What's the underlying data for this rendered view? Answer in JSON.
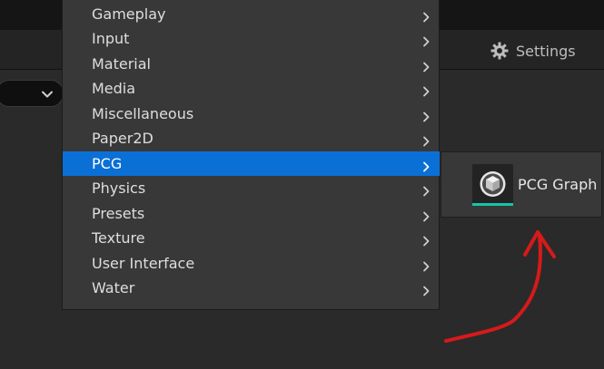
{
  "toolbar": {
    "settings_label": "Settings"
  },
  "menu": {
    "items": [
      {
        "label": "Gameplay"
      },
      {
        "label": "Input"
      },
      {
        "label": "Material"
      },
      {
        "label": "Media"
      },
      {
        "label": "Miscellaneous"
      },
      {
        "label": "Paper2D"
      },
      {
        "label": "PCG"
      },
      {
        "label": "Physics"
      },
      {
        "label": "Presets"
      },
      {
        "label": "Texture"
      },
      {
        "label": "User Interface"
      },
      {
        "label": "Water"
      }
    ],
    "selected": "PCG"
  },
  "submenu": {
    "items": [
      {
        "label": "PCG Graph",
        "icon": "cube-icon"
      }
    ]
  },
  "colors": {
    "selection": "#0b70d6",
    "asset_accent": "#12c7ab",
    "annotation": "#d61a1a"
  }
}
